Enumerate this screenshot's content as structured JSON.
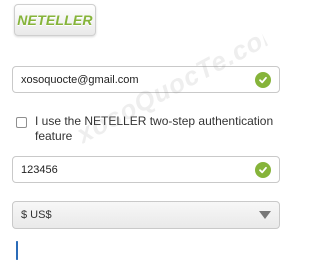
{
  "logo": {
    "text": "NETELLER"
  },
  "email_field": {
    "value": "xosoquocte@gmail.com",
    "valid_icon": "check-icon"
  },
  "two_step": {
    "label": "I use the NETELLER two-step authentication feature",
    "checked": false
  },
  "code_field": {
    "value": "123456",
    "valid_icon": "check-icon"
  },
  "currency_select": {
    "selected": "$ US$"
  },
  "remember": {
    "checked": true
  },
  "watermark": {
    "text": "xosoQuocTe.com"
  },
  "colors": {
    "accent_green": "#86b43a",
    "checkbox_blue": "#2f7bd8"
  }
}
